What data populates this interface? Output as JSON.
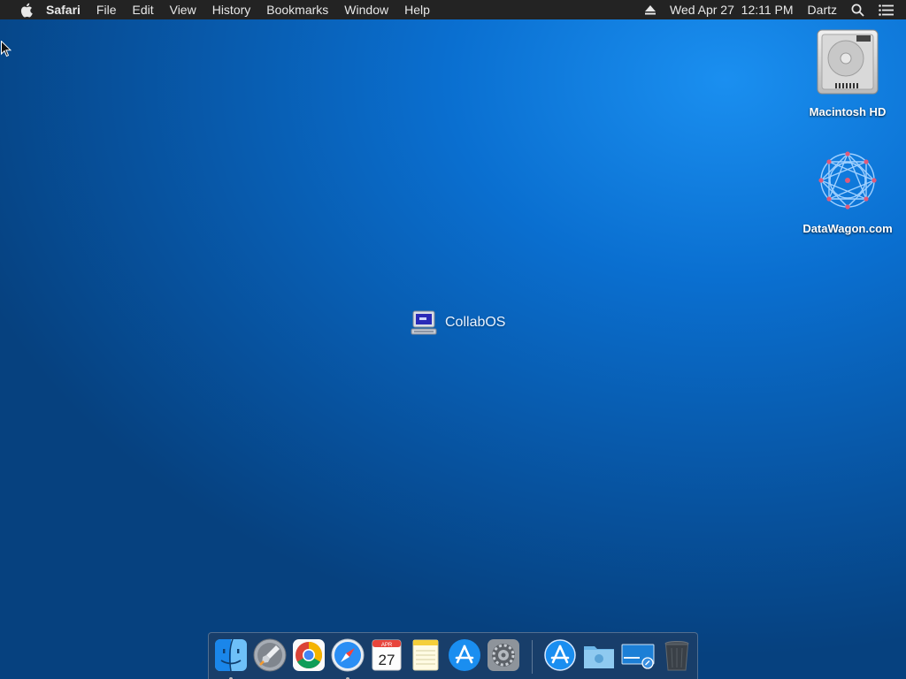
{
  "menubar": {
    "app_name": "Safari",
    "menus": [
      "File",
      "Edit",
      "View",
      "History",
      "Bookmarks",
      "Window",
      "Help"
    ],
    "clock": "Wed Apr 27  12:11 PM",
    "user": "Dartz",
    "icons": [
      "apple-icon",
      "eject-icon",
      "search-icon",
      "menu-list-icon"
    ]
  },
  "desktop": {
    "icons": [
      {
        "label": "Macintosh HD",
        "icon": "hard-drive-icon"
      },
      {
        "label": "DataWagon.com",
        "icon": "datawagon-logo-icon"
      }
    ],
    "center_app": {
      "label": "CollabOS",
      "icon": "computer-icon"
    }
  },
  "dock": {
    "items": [
      {
        "name": "Finder",
        "icon": "finder-icon",
        "running": true
      },
      {
        "name": "Launchpad",
        "icon": "launchpad-icon",
        "running": false
      },
      {
        "name": "Google Chrome",
        "icon": "chrome-icon",
        "running": false
      },
      {
        "name": "Safari",
        "icon": "safari-icon",
        "running": true
      },
      {
        "name": "Calendar",
        "icon": "calendar-icon",
        "running": false,
        "month": "APR",
        "day": "27"
      },
      {
        "name": "Notes",
        "icon": "notes-icon",
        "running": false
      },
      {
        "name": "App Store",
        "icon": "app-store-icon",
        "running": false
      },
      {
        "name": "System Preferences",
        "icon": "gear-icon",
        "running": false
      },
      {
        "name": "Applications",
        "icon": "app-store-folder-icon",
        "running": false
      },
      {
        "name": "Downloads",
        "icon": "folder-icon",
        "running": false
      },
      {
        "name": "Screen Sharing",
        "icon": "screen-sharing-icon",
        "running": false
      },
      {
        "name": "Trash",
        "icon": "trash-icon",
        "running": false
      }
    ]
  },
  "colors": {
    "menubar_bg": "#232323",
    "desktop_accent": "#0a6fd0"
  }
}
